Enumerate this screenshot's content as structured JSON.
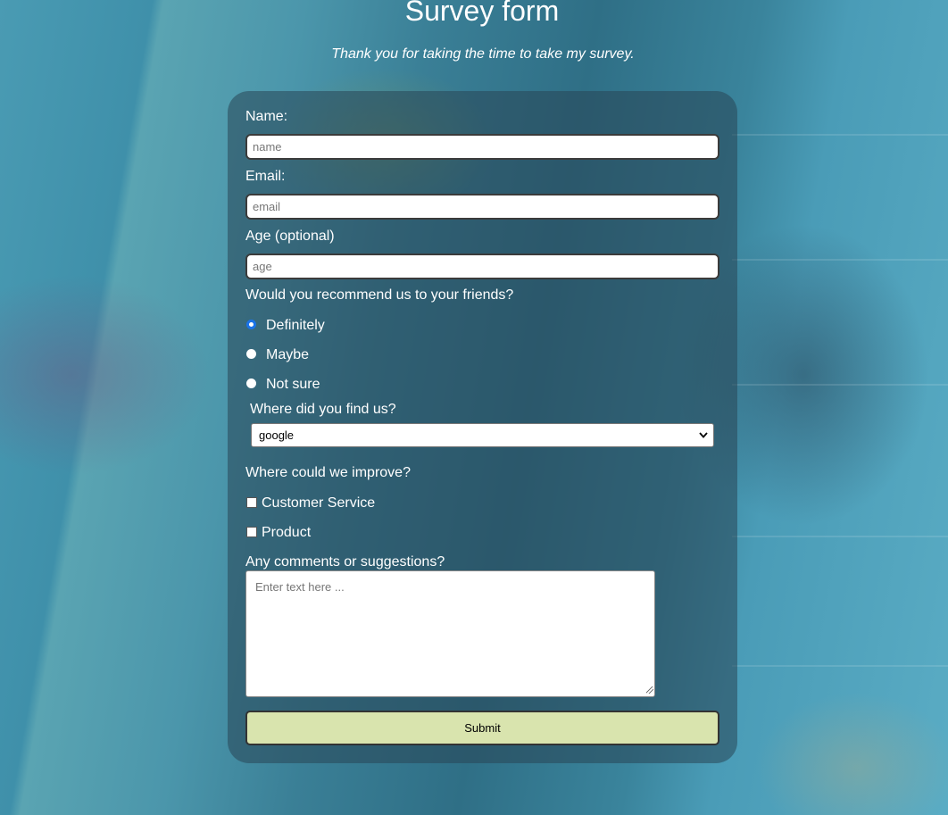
{
  "header": {
    "title": "Survey form",
    "subtitle": "Thank you for taking the time to take my survey."
  },
  "form": {
    "name": {
      "label": "Name:",
      "placeholder": "name",
      "value": ""
    },
    "email": {
      "label": "Email:",
      "placeholder": "email",
      "value": ""
    },
    "age": {
      "label": "Age (optional)",
      "placeholder": "age",
      "value": ""
    },
    "recommend": {
      "question": "Would you recommend us to your friends?",
      "options": [
        "Definitely",
        "Maybe",
        "Not sure"
      ],
      "selected": "Definitely"
    },
    "source": {
      "label": "Where did you find us?",
      "selected": "google"
    },
    "improve": {
      "question": "Where could we improve?",
      "options": [
        "Customer Service",
        "Product"
      ]
    },
    "comments": {
      "label": "Any comments or suggestions?",
      "placeholder": "Enter text here ..."
    },
    "submit_label": "Submit"
  },
  "colors": {
    "submit_bg": "#d9e4ae",
    "radio_selected": "#1a73e8"
  }
}
